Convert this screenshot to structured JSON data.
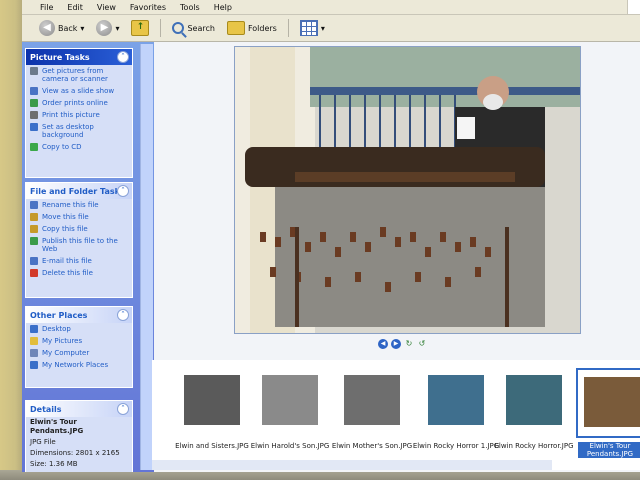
{
  "menu": [
    "File",
    "Edit",
    "View",
    "Favorites",
    "Tools",
    "Help"
  ],
  "toolbar": {
    "back_label": "Back",
    "search_label": "Search",
    "folders_label": "Folders"
  },
  "picture_tasks": {
    "title": "Picture Tasks",
    "items": [
      {
        "label": "Get pictures from camera or scanner",
        "icon": "camera-icon",
        "color": "#6c7a8c"
      },
      {
        "label": "View as a slide show",
        "icon": "slideshow-icon",
        "color": "#4a73c4"
      },
      {
        "label": "Order prints online",
        "icon": "globe-icon",
        "color": "#3a9b4a"
      },
      {
        "label": "Print this picture",
        "icon": "printer-icon",
        "color": "#6f6f6f"
      },
      {
        "label": "Set as desktop background",
        "icon": "desktop-icon",
        "color": "#3a6fc9"
      },
      {
        "label": "Copy to CD",
        "icon": "cd-icon",
        "color": "#3aa84a"
      }
    ]
  },
  "file_tasks": {
    "title": "File and Folder Tasks",
    "items": [
      {
        "label": "Rename this file",
        "icon": "rename-icon",
        "color": "#4a73c4"
      },
      {
        "label": "Move this file",
        "icon": "move-icon",
        "color": "#c59a2b"
      },
      {
        "label": "Copy this file",
        "icon": "copy-icon",
        "color": "#c59a2b"
      },
      {
        "label": "Publish this file to the Web",
        "icon": "globe-icon",
        "color": "#3a9b4a"
      },
      {
        "label": "E-mail this file",
        "icon": "email-icon",
        "color": "#4a73c4"
      },
      {
        "label": "Delete this file",
        "icon": "delete-icon",
        "color": "#d23a2a"
      }
    ]
  },
  "other_places": {
    "title": "Other Places",
    "items": [
      {
        "label": "Desktop",
        "icon": "desktop-icon",
        "color": "#3a6fc9"
      },
      {
        "label": "My Pictures",
        "icon": "folder-icon",
        "color": "#e2bd3c"
      },
      {
        "label": "My Computer",
        "icon": "computer-icon",
        "color": "#6f86b8"
      },
      {
        "label": "My Network Places",
        "icon": "network-icon",
        "color": "#3a6fc9"
      }
    ]
  },
  "details": {
    "title": "Details",
    "filename": "Elwin's Tour Pendants.JPG",
    "filetype": "JPG File",
    "dimensions": "Dimensions: 2801 x 2165",
    "size": "Size: 1.36 MB"
  },
  "filmstrip": [
    {
      "caption": "Elwin and Sisters.JPG",
      "tone": "#5a5a5a"
    },
    {
      "caption": "Elwin Harold's Son.JPG",
      "tone": "#8a8a8a"
    },
    {
      "caption": "Elwin Mother's Son.JPG",
      "tone": "#6e6e6e"
    },
    {
      "caption": "Elwin Rocky Horror 1.JPG",
      "tone": "#3f6f8e"
    },
    {
      "caption": "Elwin Rocky Horror.JPG",
      "tone": "#3d6a7a"
    },
    {
      "caption": "Elwin's Tour Pendants.JPG",
      "tone": "#7a5b3a",
      "selected": true
    }
  ]
}
